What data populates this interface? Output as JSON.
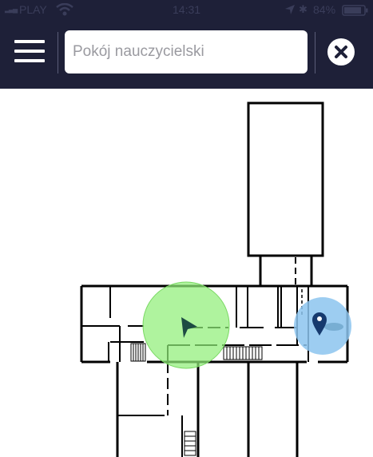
{
  "status_bar": {
    "carrier": "PLAY",
    "time": "14:31",
    "battery": "84%"
  },
  "search": {
    "value": "Pokój nauczycielski"
  },
  "icons": {
    "menu": "hamburger-icon",
    "clear": "close-icon",
    "wifi": "wifi-icon",
    "location": "location-arrow-icon",
    "bluetooth": "bluetooth-icon",
    "battery": "battery-icon",
    "user_position": "navigation-arrow-icon",
    "destination": "map-pin-icon"
  },
  "colors": {
    "header": "#1e2038",
    "user_zone": "#90ee78",
    "target_zone": "#8cc4ee",
    "walls": "#000000"
  }
}
